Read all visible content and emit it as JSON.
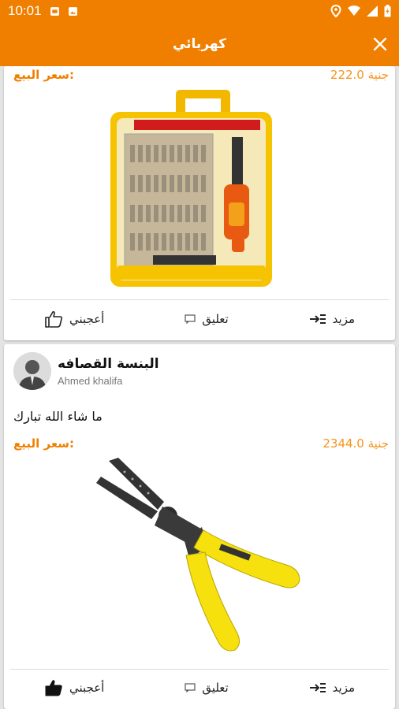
{
  "status_bar": {
    "time": "10:01"
  },
  "app_bar": {
    "title": "كهربائي"
  },
  "posts": [
    {
      "price_label": "سعر البيع:",
      "price_value": "جنية 222.0",
      "image": "screwdriver-set",
      "actions": {
        "like": "أعجبني",
        "comment": "تعليق",
        "more": "مزيد"
      }
    },
    {
      "title": "البنسة القصافه",
      "author": "Ahmed khalifa",
      "text": "ما شاء الله تبارك",
      "price_label": "سعر البيع:",
      "price_value": "جنية 2344.0",
      "image": "wire-stripper-pliers",
      "actions": {
        "like": "أعجبني",
        "comment": "تعليق",
        "more": "مزيد"
      }
    }
  ],
  "colors": {
    "primary": "#f07f00",
    "price": "#f7941d",
    "tool_yellow": "#f6d70e"
  }
}
